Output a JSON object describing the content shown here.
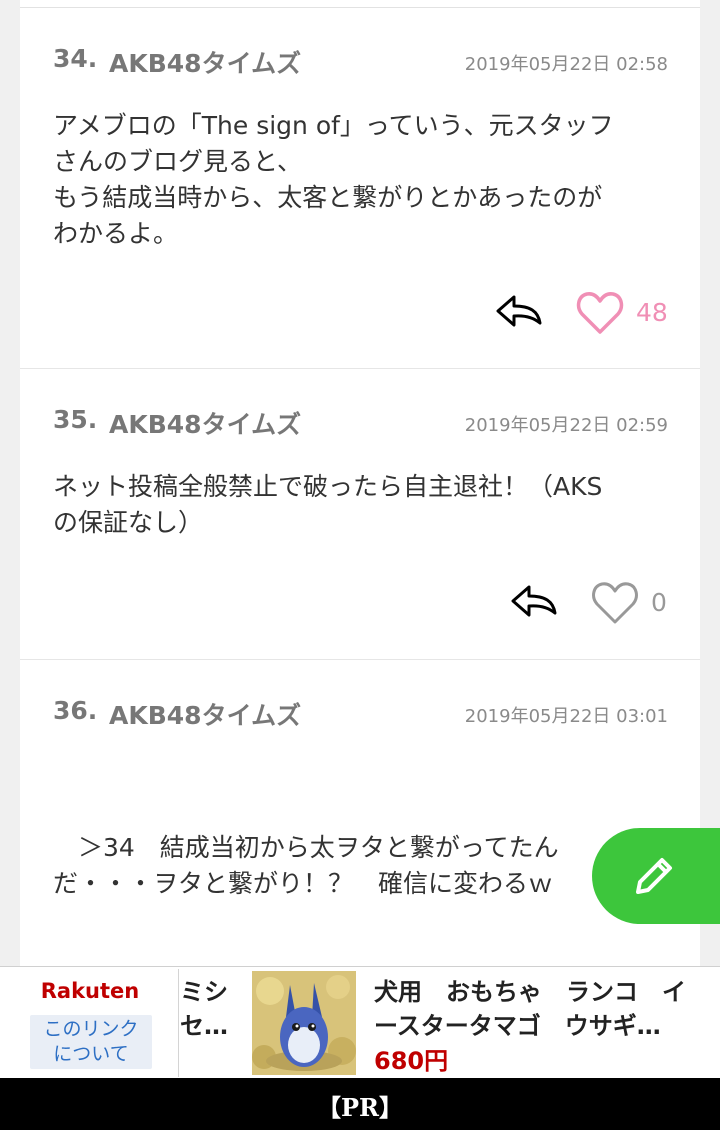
{
  "comments": [
    {
      "number": "34.",
      "author": "AKB48タイムズ",
      "date": "2019年05月22日 02:58",
      "body": "アメブロの「The sign of」っていう、元スタッフ\nさんのブログ見ると、\nもう結成当時から、太客と繋がりとかあったのが\nわかるよ。",
      "likes": "48",
      "liked_color": "#f08fb5"
    },
    {
      "number": "35.",
      "author": "AKB48タイムズ",
      "date": "2019年05月22日 02:59",
      "body": "ネット投稿全般禁止で破ったら自主退社！（AKS\nの保証なし）",
      "likes": "0",
      "liked_color": "#999999"
    },
    {
      "number": "36.",
      "author": "AKB48タイムズ",
      "date": "2019年05月22日 03:01",
      "body": "　＞34　結成当初から太ヲタと繋がってたん\nだ・・・ヲタと繋がり！？　確信に変わるｗ",
      "likes": "",
      "liked_color": "#999999"
    }
  ],
  "fab": {
    "icon": "pencil-icon",
    "color": "#3dc63c"
  },
  "ad": {
    "brand": "Rakuten",
    "link_label": "このリンク\nについて",
    "prev_item_text": "ミシ\nセ…",
    "product_title": "犬用　おもちゃ　ランコ　イースタータマゴ　ウサギ…",
    "product_price": "680円",
    "pr_label": "【PR】"
  }
}
